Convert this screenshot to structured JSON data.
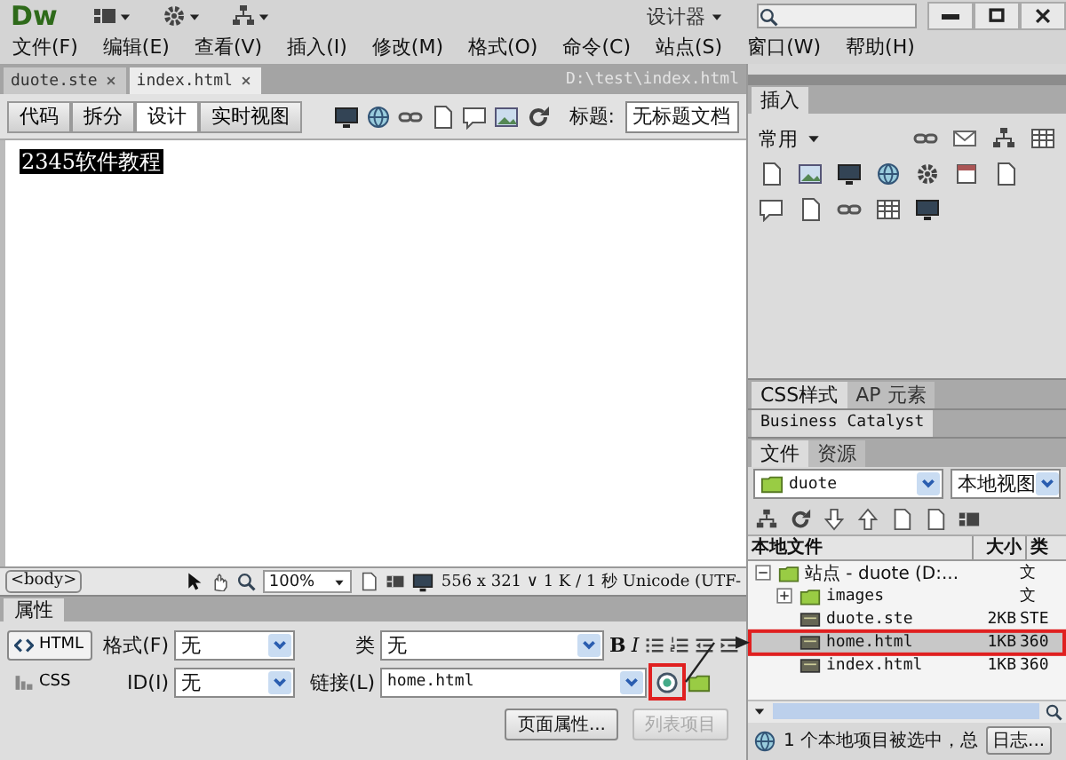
{
  "app": {
    "logo": "Dw",
    "workspace": "设计器"
  },
  "menu": [
    "文件(F)",
    "编辑(E)",
    "查看(V)",
    "插入(I)",
    "修改(M)",
    "格式(O)",
    "命令(C)",
    "站点(S)",
    "窗口(W)",
    "帮助(H)"
  ],
  "doc_tabs": [
    {
      "label": "duote.ste",
      "selected": false
    },
    {
      "label": "index.html",
      "selected": true
    }
  ],
  "doc_path": "D:\\test\\index.html",
  "view_buttons": [
    {
      "label": "代码",
      "selected": false
    },
    {
      "label": "拆分",
      "selected": false
    },
    {
      "label": "设计",
      "selected": true
    },
    {
      "label": "实时视图",
      "selected": false
    }
  ],
  "title_field": {
    "label": "标题:",
    "value": "无标题文档"
  },
  "document": {
    "selected_text": "2345软件教程"
  },
  "status_bar": {
    "tag": "<body>",
    "zoom": "100%",
    "info": "556 x 321 ∨ 1 K / 1 秒 Unicode (UTF-"
  },
  "properties": {
    "title": "属性",
    "modes": [
      {
        "label": "HTML",
        "selected": true
      },
      {
        "label": "CSS",
        "selected": false
      }
    ],
    "format_label": "格式(F)",
    "format_value": "无",
    "id_label": "ID(I)",
    "id_value": "无",
    "class_label": "类",
    "class_value": "无",
    "link_label": "链接(L)",
    "link_value": "home.html",
    "bold": "B",
    "italic": "I",
    "page_button": "页面属性...",
    "list_button": {
      "label": "列表项目",
      "disabled": true
    }
  },
  "insert_panel": {
    "tab": "插入",
    "category": "常用"
  },
  "css_panel": {
    "tabs": [
      {
        "label": "CSS样式",
        "selected": true
      },
      {
        "label": "AP 元素",
        "selected": false
      }
    ]
  },
  "bc_panel": {
    "tabs": [
      {
        "label": "Business Catalyst",
        "selected": true
      }
    ]
  },
  "files_panel": {
    "tabs": [
      {
        "label": "文件",
        "selected": true
      },
      {
        "label": "资源",
        "selected": false
      }
    ],
    "site": "duote",
    "view": "本地视图",
    "columns": [
      "本地文件",
      "大小",
      "类"
    ],
    "tree": [
      {
        "kind": "site",
        "name": "站点 - duote (D:...",
        "type": "文",
        "expanded": true,
        "selected": false,
        "children": [
          {
            "kind": "folder",
            "name": "images",
            "type": "文",
            "expanded": false,
            "selected": false
          },
          {
            "kind": "file",
            "name": "duote.ste",
            "size": "2KB",
            "type": "STE",
            "selected": false
          },
          {
            "kind": "file",
            "name": "home.html",
            "size": "1KB",
            "type": "360",
            "selected": true
          },
          {
            "kind": "file",
            "name": "index.html",
            "size": "1KB",
            "type": "360",
            "selected": false
          }
        ]
      }
    ],
    "status": "1 个本地项目被选中，总",
    "log_button": "日志..."
  }
}
